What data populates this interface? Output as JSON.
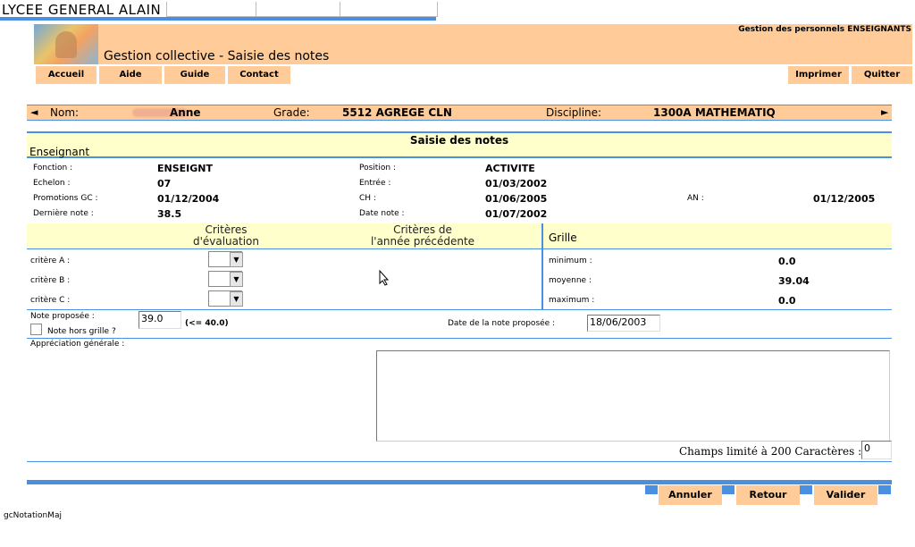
{
  "window": {
    "school_name": "LYCEE GENERAL ALAIN"
  },
  "header": {
    "title": "Gestion collective - Saisie des notes",
    "module": "Gestion des personnels ENSEIGNANTS"
  },
  "nav": {
    "left": [
      "Accueil",
      "Aide",
      "Guide",
      "Contact"
    ],
    "right": [
      "Imprimer",
      "Quitter"
    ]
  },
  "identity": {
    "prev_arrow": "◄",
    "next_arrow": "►",
    "nom_label": "Nom:",
    "nom_value": "Anne",
    "grade_label": "Grade:",
    "grade_value": "5512 AGREGE CLN",
    "discipline_label": "Discipline:",
    "discipline_value": "1300A MATHEMATIQ"
  },
  "section": {
    "title": "Saisie des notes",
    "subtitle": "Enseignant"
  },
  "details": {
    "fonction_label": "Fonction :",
    "fonction_value": "ENSEIGNT",
    "position_label": "Position :",
    "position_value": "ACTIVITE",
    "echelon_label": "Echelon :",
    "echelon_value": "07",
    "entree_label": "Entrée :",
    "entree_value": "01/03/2002",
    "promotions_label": "Promotions GC :",
    "promotions_value": "01/12/2004",
    "ch_label": "CH :",
    "ch_value": "01/06/2005",
    "an_label": "AN :",
    "an_value": "01/12/2005",
    "derniere_label": "Dernière note :",
    "derniere_value": "38.5",
    "datenote_label": "Date note :",
    "datenote_value": "01/07/2002"
  },
  "criteres": {
    "eval_header_1": "Critères",
    "eval_header_2": "d'évaluation",
    "prev_header_1": "Critères de",
    "prev_header_2": "l'année précédente",
    "rows": [
      "critère A :",
      "critère B :",
      "critère C :"
    ]
  },
  "grille": {
    "title": "Grille",
    "min_label": "minimum :",
    "min_value": "0.0",
    "moy_label": "moyenne :",
    "moy_value": "39.04",
    "max_label": "maximum :",
    "max_value": "0.0"
  },
  "note": {
    "proposee_label": "Note proposée :",
    "proposee_value": "39.0",
    "limit_hint": "(<= 40.0)",
    "hors_grille_label": "Note hors grille ?",
    "date_label": "Date de la note proposée :",
    "date_value": "18/06/2003"
  },
  "appreciation": {
    "label": "Appréciation générale :",
    "limit_label": "Champs limité à 200 Caractères :",
    "count_value": "0"
  },
  "footer": {
    "buttons": [
      "Annuler",
      "Retour",
      "Valider"
    ],
    "page_id": "gcNotationMaj"
  }
}
